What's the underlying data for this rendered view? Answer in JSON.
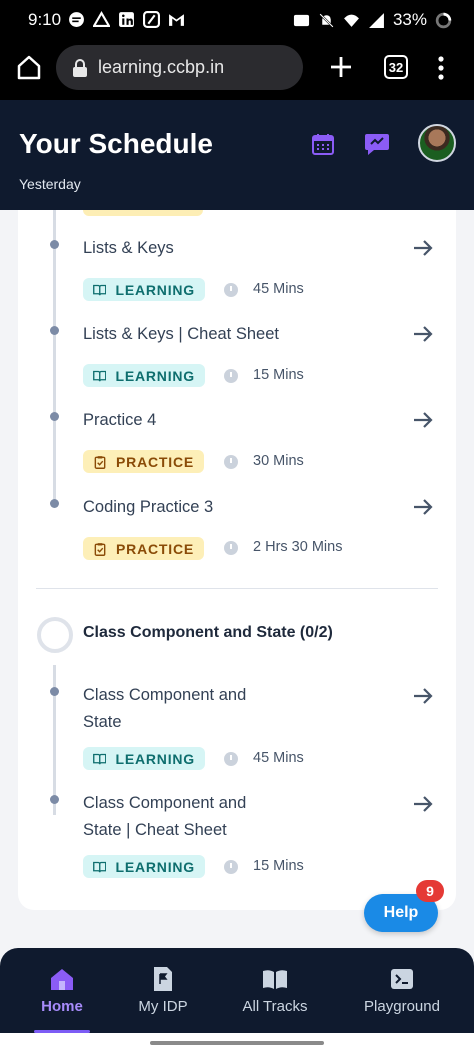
{
  "status": {
    "time": "9:10",
    "battery": "33%"
  },
  "browser": {
    "url": "learning.ccbp.in",
    "tab_count": "32"
  },
  "header": {
    "title": "Your Schedule",
    "subtitle": "Yesterday"
  },
  "items_top": [
    {
      "title": "Lists & Keys",
      "type": "LEARNING",
      "duration": "45 Mins"
    },
    {
      "title": "Lists & Keys | Cheat Sheet",
      "type": "LEARNING",
      "duration": "15 Mins"
    },
    {
      "title": "Practice 4",
      "type": "PRACTICE",
      "duration": "30 Mins"
    },
    {
      "title": "Coding Practice 3",
      "type": "PRACTICE",
      "duration": "2 Hrs 30 Mins"
    }
  ],
  "section": {
    "title": "Class Component and State (0/2)"
  },
  "items_bottom": [
    {
      "title": "Class Component and State",
      "type": "LEARNING",
      "duration": "45 Mins"
    },
    {
      "title": "Class Component and State | Cheat Sheet",
      "type": "LEARNING",
      "duration": "15 Mins"
    }
  ],
  "help": {
    "label": "Help",
    "count": "9"
  },
  "nav": {
    "home": "Home",
    "idp": "My IDP",
    "tracks": "All Tracks",
    "playground": "Playground"
  },
  "colors": {
    "accent": "#7c5cf5",
    "header_bg": "#0f1a2e",
    "learning_bg": "#d6f5f5",
    "practice_bg": "#fdefb8",
    "help": "#1a8ae6"
  }
}
